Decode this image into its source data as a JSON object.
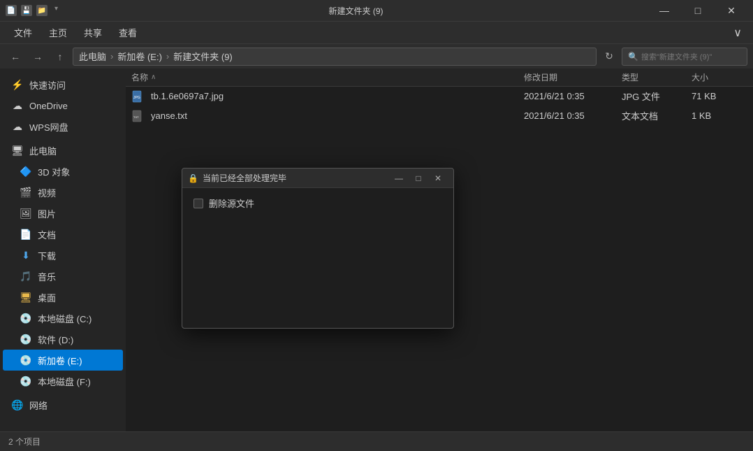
{
  "titleBar": {
    "title": "新建文件夹 (9)",
    "icons": [
      "📄",
      "💾",
      "📁"
    ],
    "controls": [
      "—",
      "□",
      "✕"
    ]
  },
  "menuBar": {
    "items": [
      "文件",
      "主页",
      "共享",
      "查看"
    ],
    "chevron": "∨"
  },
  "navBar": {
    "back": "←",
    "forward": "→",
    "up": "↑",
    "breadcrumb": [
      "此电脑",
      "新加卷 (E:)",
      "新建文件夹 (9)"
    ],
    "refresh": "↻",
    "searchPlaceholder": "搜索\"新建文件夹 (9)\""
  },
  "sidebar": {
    "items": [
      {
        "icon": "★",
        "label": "快速访问"
      },
      {
        "icon": "☁",
        "label": "OneDrive"
      },
      {
        "icon": "☁",
        "label": "WPS网盘"
      },
      {
        "icon": "🖥",
        "label": "此电脑",
        "type": "header"
      },
      {
        "icon": "🎲",
        "label": "3D 对象"
      },
      {
        "icon": "🎬",
        "label": "视频"
      },
      {
        "icon": "🖼",
        "label": "图片"
      },
      {
        "icon": "📄",
        "label": "文档"
      },
      {
        "icon": "⬇",
        "label": "下载"
      },
      {
        "icon": "🎵",
        "label": "音乐"
      },
      {
        "icon": "🖥",
        "label": "桌面"
      },
      {
        "icon": "💾",
        "label": "本地磁盘 (C:)"
      },
      {
        "icon": "💾",
        "label": "软件 (D:)"
      },
      {
        "icon": "💾",
        "label": "新加卷 (E:)",
        "selected": true
      },
      {
        "icon": "💾",
        "label": "本地磁盘 (F:)"
      },
      {
        "icon": "🌐",
        "label": "网络"
      }
    ]
  },
  "fileList": {
    "headers": {
      "name": "名称",
      "date": "修改日期",
      "type": "类型",
      "size": "大小"
    },
    "files": [
      {
        "icon": "img",
        "name": "tb.1.6e0697a7.jpg",
        "date": "2021/6/21 0:35",
        "type": "JPG 文件",
        "size": "71 KB"
      },
      {
        "icon": "txt",
        "name": "yanse.txt",
        "date": "2021/6/21 0:35",
        "type": "文本文档",
        "size": "1 KB"
      }
    ]
  },
  "statusBar": {
    "text": "2 个项目"
  },
  "dialog": {
    "title": "当前已经全部处理完毕",
    "lockIcon": "🔒",
    "controls": [
      "—",
      "□",
      "✕"
    ],
    "checkbox": {
      "checked": false,
      "label": "删除源文件"
    }
  }
}
